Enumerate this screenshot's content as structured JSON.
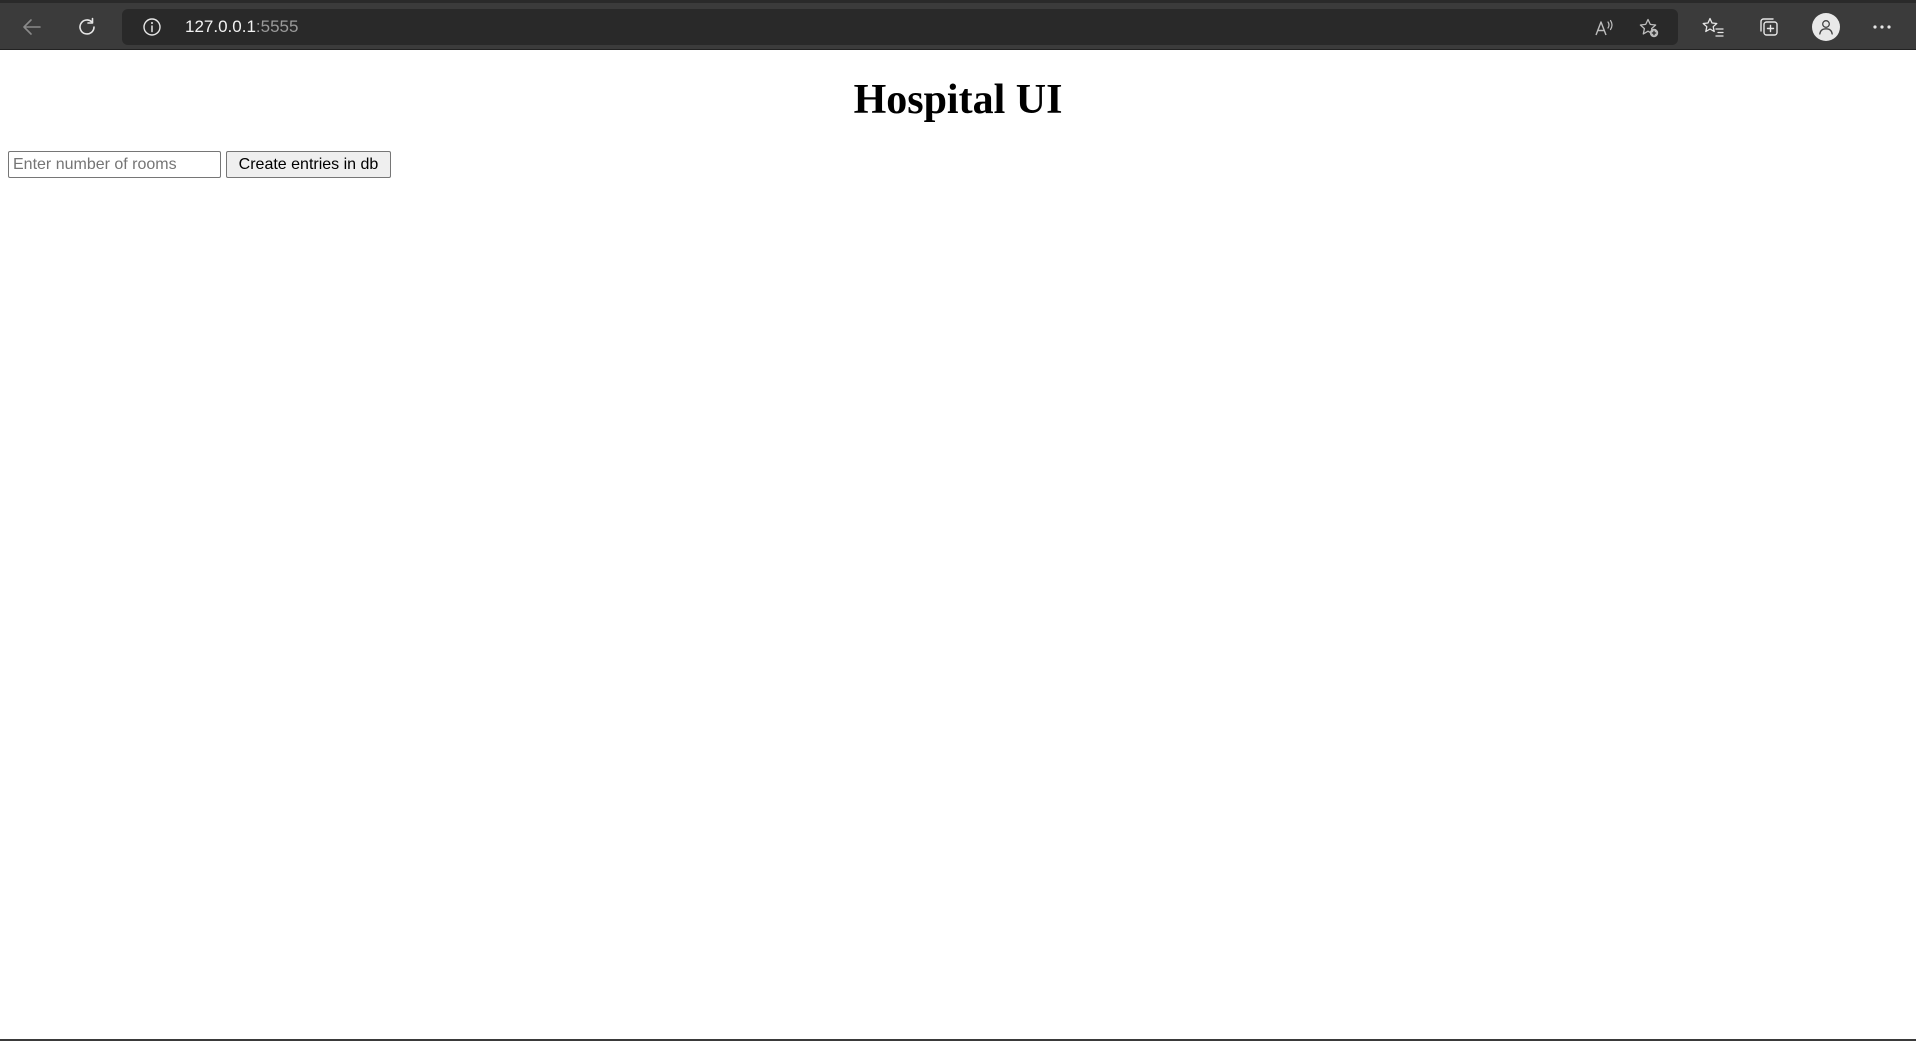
{
  "browser": {
    "url_host": "127.0.0.1",
    "url_port": ":5555",
    "icons": {
      "back": "arrow-left-icon",
      "refresh": "refresh-icon",
      "site_info": "info-icon",
      "read_aloud": "read-aloud-icon",
      "add_favorite": "star-plus-icon",
      "favorites": "favorites-list-icon",
      "collections": "collections-icon",
      "profile": "profile-icon",
      "more": "more-dots-icon"
    },
    "colors": {
      "toolbar_bg": "#3b3b3b",
      "address_bar_bg": "#292929"
    }
  },
  "page": {
    "title": "Hospital UI",
    "rooms_input": {
      "placeholder": "Enter number of rooms",
      "value": ""
    },
    "create_button_label": "Create entries in db"
  }
}
